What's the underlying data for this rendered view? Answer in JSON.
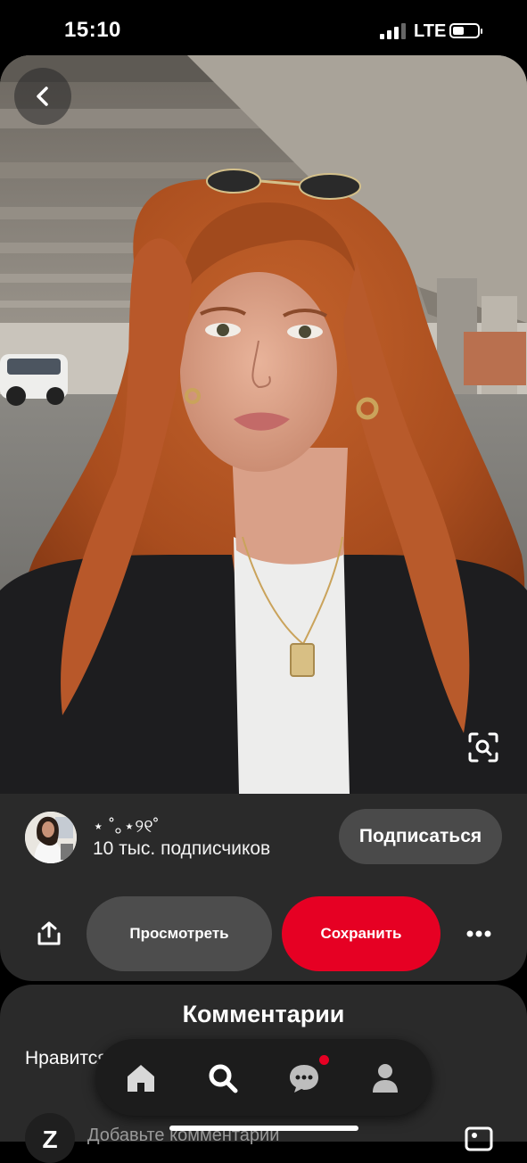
{
  "status_bar": {
    "time": "15:10",
    "network": "LTE"
  },
  "pin": {
    "author": {
      "name": "⋆ ˚｡⋆୨୧˚",
      "followers": "10 тыс. подписчиков"
    },
    "follow_label": "Подписаться",
    "view_label": "Просмотреть",
    "save_label": "Сохранить"
  },
  "comments": {
    "title": "Комментарии",
    "prompt": "Нравится? Расскажите об этом!",
    "my_initial": "Z",
    "input_placeholder": "Добавьте комментарий"
  },
  "nav": {
    "items": [
      "home-icon",
      "search-icon",
      "messages-icon",
      "profile-icon"
    ],
    "active": "search-icon",
    "notification_color": "#e60023"
  },
  "colors": {
    "accent": "#e60023",
    "panel": "#2a2a2a",
    "background": "#000000"
  }
}
